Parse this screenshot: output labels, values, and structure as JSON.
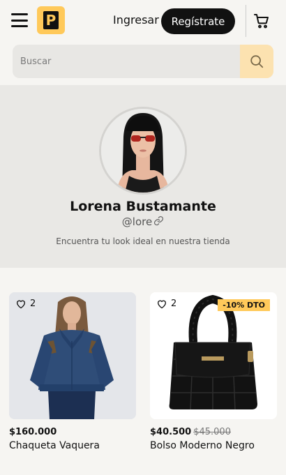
{
  "header": {
    "logo_letter": "P",
    "login_label": "Ingresar",
    "register_label": "Regístrate"
  },
  "search": {
    "placeholder": "Buscar",
    "value": ""
  },
  "profile": {
    "name": "Lorena Bustamante",
    "handle": "@lore",
    "bio": "Encuentra tu look ideal en nuestra tienda"
  },
  "products": [
    {
      "title": "Chaqueta Vaquera",
      "price": "$160.000",
      "old_price": "",
      "likes": "2",
      "badge": ""
    },
    {
      "title": "Bolso Moderno Negro",
      "price": "$40.500",
      "old_price": "$45.000",
      "likes": "2",
      "badge": "-10% DTO"
    }
  ],
  "colors": {
    "accent": "#ffc95a",
    "search_button": "#fce2b0",
    "background": "#f6f5f2",
    "profile_band": "#e9e8e5"
  },
  "icons": [
    "menu-icon",
    "cart-icon",
    "search-icon",
    "link-icon",
    "heart-icon"
  ]
}
